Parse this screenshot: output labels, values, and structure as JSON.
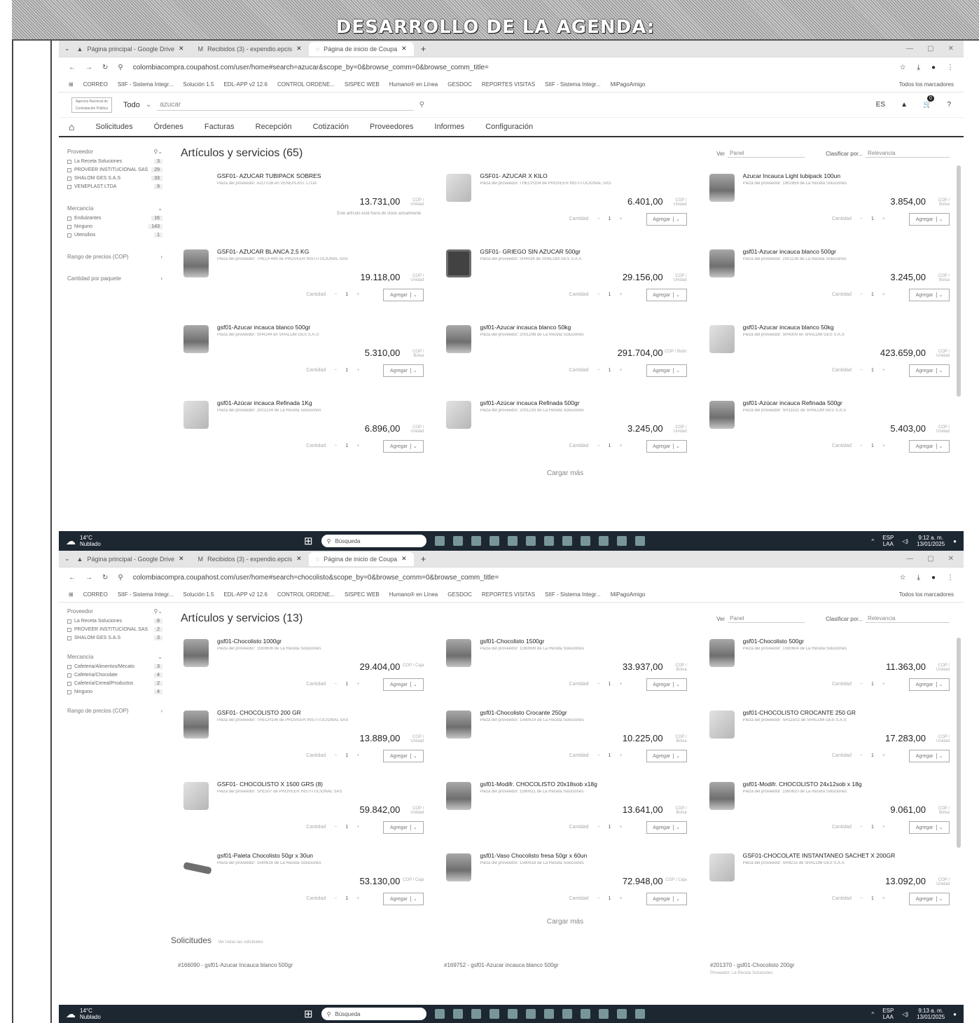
{
  "banner_title": "DESARROLLO DE LA AGENDA:",
  "browser": {
    "tabs": [
      {
        "label": "Página principal - Google Drive"
      },
      {
        "label": "Recibidos (3) - expendio.epcis"
      },
      {
        "label": "Página de inicio de Coupa"
      }
    ],
    "new_tab": "+",
    "bookmarks": [
      "CORREO",
      "SIIF - Sistema Integr...",
      "Solución 1.5",
      "EDL-APP v2 12.6",
      "CONTROL ORDENE...",
      "SISPEC WEB",
      "Humano® en Línea",
      "GESDOC",
      "REPORTES VISITAS",
      "SIIF - Sistema Integr...",
      "MiPagoAmigo"
    ],
    "all_bookmarks": "Todos los marcadores"
  },
  "app": {
    "logo_text": "Agencia Nacional de Contratación Pública",
    "scope": "Todo",
    "lang": "ES",
    "cart_count": "0",
    "help": "?",
    "nav": [
      "Solicitudes",
      "Órdenes",
      "Facturas",
      "Recepción",
      "Cotización",
      "Proveedores",
      "Informes",
      "Configuración"
    ]
  },
  "shot1": {
    "url": "colombiacompra.coupahost.com/user/home#search=azucar&scope_by=0&browse_comm=0&browse_comm_title=",
    "search_query": "azucar",
    "title": "Artículos y servicios (65)",
    "view_label": "Ver",
    "view_value": "Panel",
    "sort_label": "Clasificar por...",
    "sort_value": "Relevancia",
    "sidebar": {
      "supplier_header": "Proveedor",
      "suppliers": [
        {
          "name": "La Receta Soluciones",
          "count": "3"
        },
        {
          "name": "PROVEER INSTITUCIONAL SAS",
          "count": "29"
        },
        {
          "name": "SHALOM GES S.A.S",
          "count": "33"
        },
        {
          "name": "VENEPLAST LTDA",
          "count": "9"
        }
      ],
      "commodity_header": "Mercancía",
      "commodities": [
        {
          "name": "Endulzantes",
          "count": "16"
        },
        {
          "name": "Ninguno",
          "count": "143"
        },
        {
          "name": "Utensilios",
          "count": "1"
        }
      ],
      "price_range": "Rango de precios (COP)",
      "pack_qty": "Cantidad por paquete"
    },
    "items": [
      {
        "name": "GSF01- AZUCAR TUBIPACK SOBRES",
        "supplier": "Pieza del proveedor: AZUTUB en VENEPLAST LTDA",
        "price": "13.731,00",
        "unit": "COP / Unidad",
        "note": "Este artículo está fuera de stock actualmente",
        "qty": "",
        "add": "",
        "thumb": "none"
      },
      {
        "name": "GSF01- AZUCAR X KILO",
        "supplier": "Pieza del proveedor: THECH104 de PROVEER INSTITUCIONAL SAS",
        "price": "6.401,00",
        "unit": "COP / Unidad",
        "note": "",
        "qty": "1",
        "add": "Agregar",
        "thumb": "light"
      },
      {
        "name": "Azucar Incauca Light tubipack 100un",
        "supplier": "Pieza del proveedor: 1902859 de La Receta Soluciones",
        "price": "3.854,00",
        "unit": "COP / Bolsa",
        "note": "",
        "qty": "1",
        "add": "Agregar",
        "thumb": "normal"
      },
      {
        "name": "GSF01- AZUCAR BLANCA 2,5 KG",
        "supplier": "Pieza del proveedor: THECF449 de PROVEER INSTITUCIONAL SAS",
        "price": "19.118,00",
        "unit": "COP / Unidad",
        "note": "",
        "qty": "1",
        "add": "Agregar",
        "thumb": "normal"
      },
      {
        "name": "GSF01- GRIEGO SIN AZUCAR 500gr",
        "supplier": "Pieza del proveedor: SH4034 de SHALOM GES S.A.S",
        "price": "29.156,00",
        "unit": "COP / Unidad",
        "note": "",
        "qty": "1",
        "add": "Agregar",
        "thumb": "dark"
      },
      {
        "name": "gsf01-Azucar incauca blanco 500gr",
        "supplier": "Pieza del proveedor: 2001139 de La Receta Soluciones",
        "price": "3.245,00",
        "unit": "COP / Bolsa",
        "note": "",
        "qty": "1",
        "add": "Agregar",
        "thumb": "normal"
      },
      {
        "name": "gsf01-Azucar incauca blanco 500gr",
        "supplier": "Pieza del proveedor: SH4144 en SHALOM GES S.A.S",
        "price": "5.310,00",
        "unit": "COP / Bolsa",
        "note": "",
        "qty": "1",
        "add": "Agregar",
        "thumb": "normal"
      },
      {
        "name": "gsf01-Azucar incauca blanco 50kg",
        "supplier": "Pieza del proveedor: 2001298 de La Receta Soluciones",
        "price": "291.704,00",
        "unit": "COP / Bulto",
        "note": "",
        "qty": "1",
        "add": "Agregar",
        "thumb": "normal"
      },
      {
        "name": "gsf01-Azucar incauca blanco 50kg",
        "supplier": "Pieza del proveedor: SH4309 en SHALOM GES S.A.S",
        "price": "423.659,00",
        "unit": "COP / Unidad",
        "note": "",
        "qty": "1",
        "add": "Agregar",
        "thumb": "light"
      },
      {
        "name": "gsf01-Azúcar incauca Refinada 1Kg",
        "supplier": "Pieza del proveedor: 2001234 de La Receta Soluciones",
        "price": "6.896,00",
        "unit": "COP / Unidad",
        "note": "",
        "qty": "1",
        "add": "Agregar",
        "thumb": "light"
      },
      {
        "name": "gsf01-Azúcar incauca Refinada 500gr",
        "supplier": "Pieza del proveedor: 2001233 de La Receta Soluciones",
        "price": "3.245,00",
        "unit": "COP / Unidad",
        "note": "",
        "qty": "1",
        "add": "Agregar",
        "thumb": "light"
      },
      {
        "name": "gsf01-Azúcar incauca Refinada 500gr",
        "supplier": "Pieza del proveedor: SH11511 de SHALOM GES S.A.S",
        "price": "5.403,00",
        "unit": "COP / Unidad",
        "note": "",
        "qty": "1",
        "add": "Agregar",
        "thumb": "normal"
      }
    ],
    "load_more": "Cargar más"
  },
  "shot2": {
    "url": "colombiacompra.coupahost.com/user/home#search=chocolisto&scope_by=0&browse_comm=0&browse_comm_title=",
    "title": "Artículos y servicios (13)",
    "view_label": "Ver",
    "view_value": "Panel",
    "sort_label": "Clasificar por...",
    "sort_value": "Relevancia",
    "sidebar": {
      "supplier_header": "Proveedor",
      "suppliers": [
        {
          "name": "La Receta Soluciones",
          "count": "8"
        },
        {
          "name": "PROVEER INSTITUCIONAL SAS",
          "count": "2"
        },
        {
          "name": "SHALOM GES S.A.S",
          "count": "3"
        }
      ],
      "commodity_header": "Mercancía",
      "commodities": [
        {
          "name": "Cafeteria/Alimentos/Mecato",
          "count": "3"
        },
        {
          "name": "Cafeteria/Chocolate",
          "count": "4"
        },
        {
          "name": "Cafeteria/Cereal/Productos",
          "count": "2"
        },
        {
          "name": "Ninguno",
          "count": "4"
        }
      ],
      "price_range": "Rango de precios (COP)"
    },
    "items": [
      {
        "name": "gsf01-Chocolisto 1000gr",
        "supplier": "Pieza del proveedor: 1560606 de La Receta Soluciones",
        "price": "29.404,00",
        "unit": "COP / Caja",
        "qty": "1",
        "add": "Agregar",
        "thumb": "normal"
      },
      {
        "name": "gsf01-Chocolisto 1500gr",
        "supplier": "Pieza del proveedor: 1560609 de La Receta Soluciones",
        "price": "33.937,00",
        "unit": "COP / Bolsa",
        "qty": "1",
        "add": "Agregar",
        "thumb": "normal"
      },
      {
        "name": "gsf01-Chocolisto 500gr",
        "supplier": "Pieza del proveedor: 1560604 de La Receta Soluciones",
        "price": "11.363,00",
        "unit": "COP / Unidad",
        "qty": "1",
        "add": "Agregar",
        "thumb": "normal"
      },
      {
        "name": "GSF01- CHOCOLISTO 200 GR",
        "supplier": "Pieza del proveedor: THECH106 de PROVEER INSTITUCIONAL SAS",
        "price": "13.889,00",
        "unit": "COP / Unidad",
        "qty": "1",
        "add": "Agregar",
        "thumb": "normal"
      },
      {
        "name": "gsf01-Chocolisto Crocante 250gr",
        "supplier": "Pieza del proveedor: 1560614 de La Receta Soluciones",
        "price": "10.225,00",
        "unit": "COP / Bolsa",
        "qty": "1",
        "add": "Agregar",
        "thumb": "normal"
      },
      {
        "name": "gsf01-CHOCOLISTO CROCANTE 250 GR",
        "supplier": "Pieza del proveedor: SH11502 de SHALOM GES S.A.S",
        "price": "17.283,00",
        "unit": "COP / Unidad",
        "qty": "1",
        "add": "Agregar",
        "thumb": "light"
      },
      {
        "name": "GSF01- CHOCOLISTO X 1500 GRS (8)",
        "supplier": "Pieza del proveedor: SH1507 de PROVEER INSTITUCIONAL SAS",
        "price": "59.842,00",
        "unit": "COP / Unidad",
        "qty": "1",
        "add": "Agregar",
        "thumb": "light"
      },
      {
        "name": "gsf01-Modifr. CHOCOLISTO 20x18sob x18g",
        "supplier": "Pieza del proveedor: 1560611 de La Receta Soluciones",
        "price": "13.641,00",
        "unit": "COP / Bolsa",
        "qty": "1",
        "add": "Agregar",
        "thumb": "normal"
      },
      {
        "name": "gsf01-Modifr. CHOCOLISTO 24x12sob x 18g",
        "supplier": "Pieza del proveedor: 1560610 de La Receta Soluciones",
        "price": "9.061,00",
        "unit": "COP / Bolsa",
        "qty": "1",
        "add": "Agregar",
        "thumb": "normal"
      },
      {
        "name": "gsf01-Paleta Chocolisto 50gr x 30un",
        "supplier": "Pieza del proveedor: 1560616 de La Receta Soluciones",
        "price": "53.130,00",
        "unit": "COP / Caja",
        "qty": "1",
        "add": "Agregar",
        "thumb": "stick"
      },
      {
        "name": "gsf01-Vaso Chocolisto fresa 50gr x 60un",
        "supplier": "Pieza del proveedor: 1560618 de La Receta Soluciones",
        "price": "72.948,00",
        "unit": "COP / Caja",
        "qty": "1",
        "add": "Agregar",
        "thumb": "normal"
      },
      {
        "name": "GSF01-CHOCOLATE INSTANTANEO SACHET X 200GR",
        "supplier": "Pieza del proveedor: SH4215 de SHALOM GES S.A.S",
        "price": "13.092,00",
        "unit": "COP / Unidad",
        "qty": "1",
        "add": "Agregar",
        "thumb": "light"
      }
    ],
    "load_more": "Cargar más",
    "solicitudes_title": "Solicitudes",
    "solicitudes_link": "Ver todas las solicitudes",
    "requests": [
      {
        "title": "#166090 - gsf01-Azucar Incauca blanco 500gr",
        "sub": ""
      },
      {
        "title": "#169752 - gsf01-Azucar incauca blanco 500gr",
        "sub": ""
      },
      {
        "title": "#201370 - gsf01-Chocolisto 200gr",
        "sub": "Proveedor: La Receta Soluciones"
      }
    ]
  },
  "taskbar1": {
    "temp": "14°C",
    "cond": "Nublado",
    "search": "Búsqueda",
    "lang": "ESP",
    "layout": "LAA",
    "time": "9:12 a. m.",
    "date": "13/01/2025"
  },
  "taskbar2": {
    "temp": "14°C",
    "cond": "Nublado",
    "search": "Búsqueda",
    "lang": "ESP",
    "layout": "LAA",
    "time": "9:13 a. m.",
    "date": "13/01/2025"
  },
  "qty_label": "Cantidad"
}
